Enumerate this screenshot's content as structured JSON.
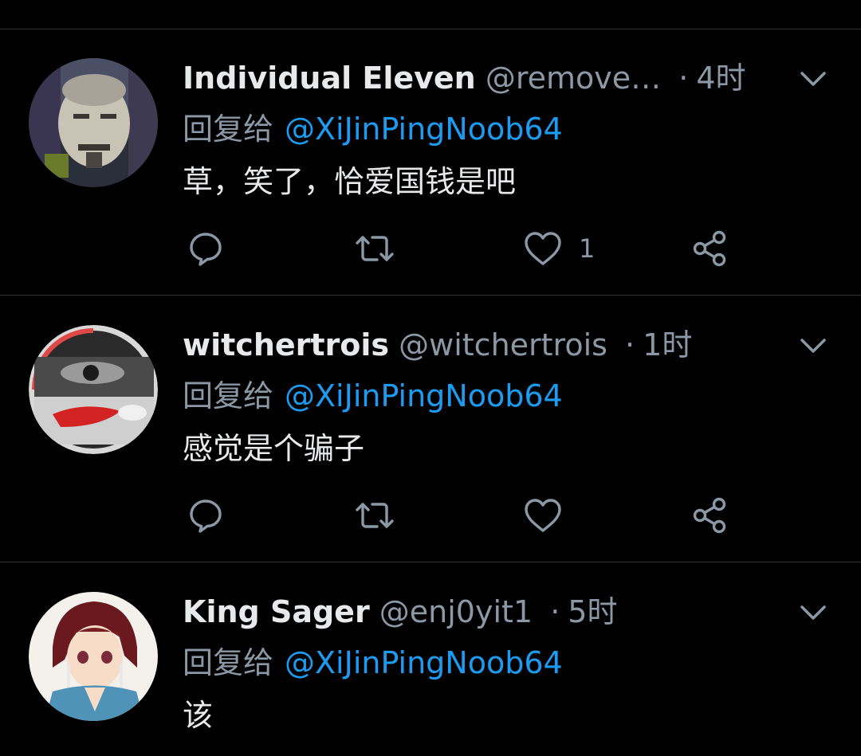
{
  "tweets": [
    {
      "display_name": "Individual Eleven",
      "handle": "@remove…",
      "separator": "·",
      "time": "4时",
      "reply_prefix": "回复给",
      "reply_to": "@XiJinPingNoob64",
      "text": "草，笑了，恰爱国钱是吧",
      "like_count": "1",
      "avatar": "old-man-photo"
    },
    {
      "display_name": "witchertrois",
      "handle": "@witchertrois",
      "separator": "·",
      "time": "1时",
      "reply_prefix": "回复给",
      "reply_to": "@XiJinPingNoob64",
      "text": "感觉是个骗子",
      "like_count": "",
      "avatar": "eye-red-lip-art"
    },
    {
      "display_name": "King Sager",
      "handle": "@enj0yit1",
      "separator": "·",
      "time": "5时",
      "reply_prefix": "回复给",
      "reply_to": "@XiJinPingNoob64",
      "text": "该",
      "like_count": "",
      "avatar": "anime-character"
    }
  ],
  "icons": {
    "reply": "reply-icon",
    "retweet": "retweet-icon",
    "like": "heart-icon",
    "share": "share-icon",
    "menu": "chevron-down-icon"
  },
  "colors": {
    "background": "#000000",
    "primary_text": "#e7e9ea",
    "secondary_text": "#8b98a5",
    "link": "#1d9bf0",
    "divider": "#2f3336"
  }
}
